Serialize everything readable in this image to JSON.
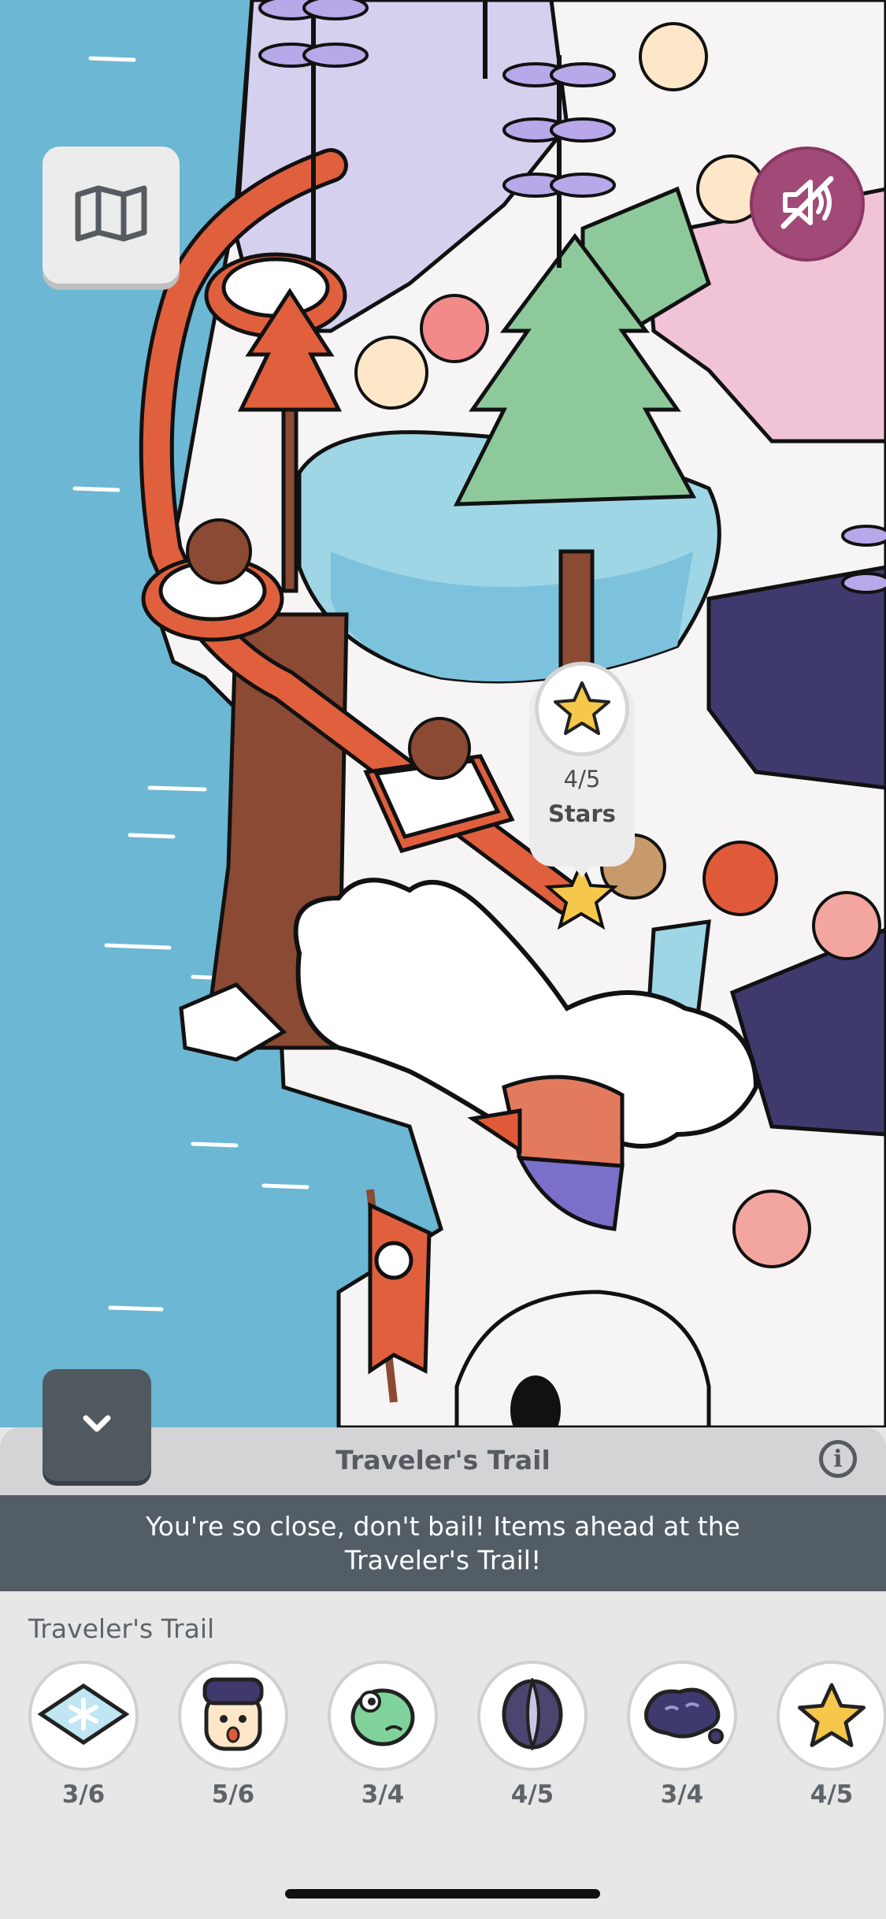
{
  "map": {
    "map_button_icon": "map-icon",
    "sound_button_icon": "sound-muted-icon",
    "hint_marker": {
      "icon": "star-icon",
      "count": "4/5",
      "label": "Stars"
    }
  },
  "panel": {
    "collapse_icon": "chevron-down-icon",
    "title": "Traveler's Trail",
    "info_icon": "info-icon",
    "info_glyph": "i",
    "banner": "You're so close, don't bail! Items ahead at the Traveler's Trail!",
    "section_label": "Traveler's Trail",
    "items": [
      {
        "icon": "snowflake-tile-icon",
        "count": "3/6"
      },
      {
        "icon": "face-head-icon",
        "count": "5/6"
      },
      {
        "icon": "green-alien-icon",
        "count": "3/4"
      },
      {
        "icon": "moon-stone-icon",
        "count": "4/5"
      },
      {
        "icon": "purple-blob-icon",
        "count": "3/4"
      },
      {
        "icon": "star-icon",
        "count": "4/5"
      }
    ]
  },
  "colors": {
    "water": "#6cb7d3",
    "sound_button": "#a14a77",
    "banner": "#535d66",
    "panel": "#e7e7e8"
  }
}
